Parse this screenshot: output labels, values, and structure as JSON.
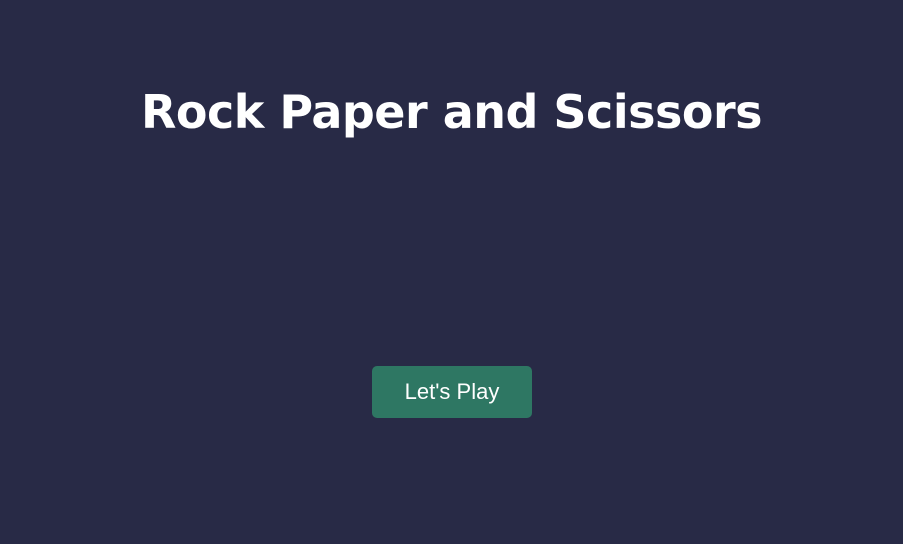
{
  "page": {
    "title": "Rock Paper and Scissors"
  },
  "actions": {
    "play_label": "Let's Play"
  },
  "colors": {
    "background": "#282a46",
    "title_text": "#ffffff",
    "button_background": "#2e7763",
    "button_text": "#ffffff"
  }
}
